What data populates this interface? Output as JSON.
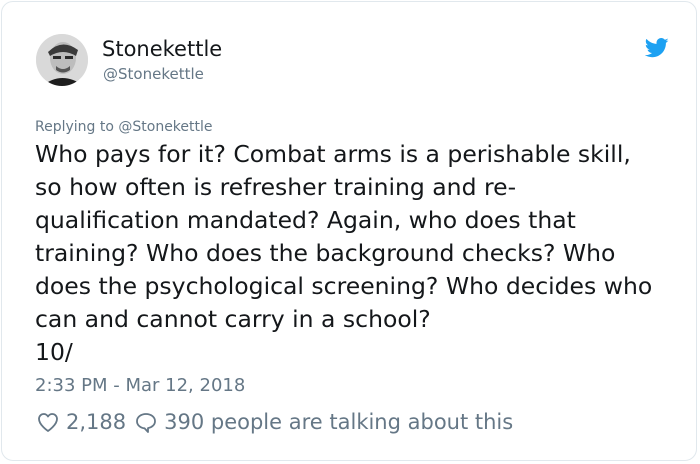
{
  "user": {
    "display_name": "Stonekettle",
    "handle": "@Stonekettle"
  },
  "tweet": {
    "replying_to": "Replying to @Stonekettle",
    "text": "Who pays for it? Combat arms is a perishable skill,\nso how often is refresher training and re-\nqualification mandated? Again, who does that\ntraining? Who does the background checks? Who\ndoes the psychological screening? Who decides who\ncan and cannot carry in a school?\n10/",
    "timestamp": "2:33 PM - Mar 12, 2018"
  },
  "stats": {
    "likes": "2,188",
    "talking": "390 people are talking about this"
  },
  "icons": {
    "bird": "twitter-bird-icon",
    "like": "heart-icon",
    "reply": "speech-bubble-icon"
  },
  "colors": {
    "brand": "#1da1f2",
    "text": "#14171a",
    "muted": "#657786"
  }
}
